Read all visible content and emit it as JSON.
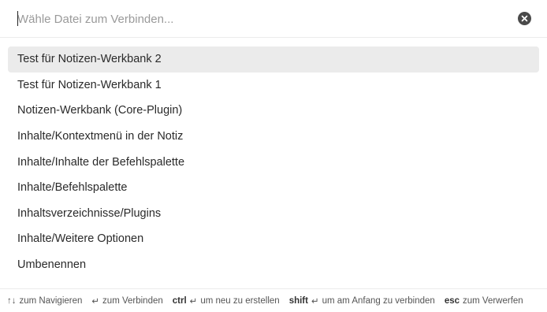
{
  "search": {
    "placeholder": "Wähle Datei zum Verbinden...",
    "value": ""
  },
  "clear_button": {
    "icon": "close-circle-icon"
  },
  "results": [
    {
      "label": "Test für Notizen-Werkbank 2",
      "selected": true
    },
    {
      "label": "Test für Notizen-Werkbank 1",
      "selected": false
    },
    {
      "label": "Notizen-Werkbank (Core-Plugin)",
      "selected": false
    },
    {
      "label": "Inhalte/Kontextmenü in der Notiz",
      "selected": false
    },
    {
      "label": "Inhalte/Inhalte der Befehlspalette",
      "selected": false
    },
    {
      "label": "Inhalte/Befehlspalette",
      "selected": false
    },
    {
      "label": "Inhaltsverzeichnisse/Plugins",
      "selected": false
    },
    {
      "label": "Inhalte/Weitere Optionen",
      "selected": false
    },
    {
      "label": "Umbenennen",
      "selected": false
    }
  ],
  "footer": {
    "navigate": {
      "glyph": "↑↓",
      "text": "zum Navigieren"
    },
    "connect": {
      "glyph": "↵",
      "text": "zum Verbinden"
    },
    "create": {
      "key": "ctrl",
      "glyph": "↵",
      "text": "um neu zu erstellen"
    },
    "prepend": {
      "key": "shift",
      "glyph": "↵",
      "text": "um am Anfang zu verbinden"
    },
    "dismiss": {
      "key": "esc",
      "text": "zum Verwerfen"
    }
  },
  "colors": {
    "selected_background": "#ebebeb",
    "clear_button": "#4a4a4a"
  }
}
